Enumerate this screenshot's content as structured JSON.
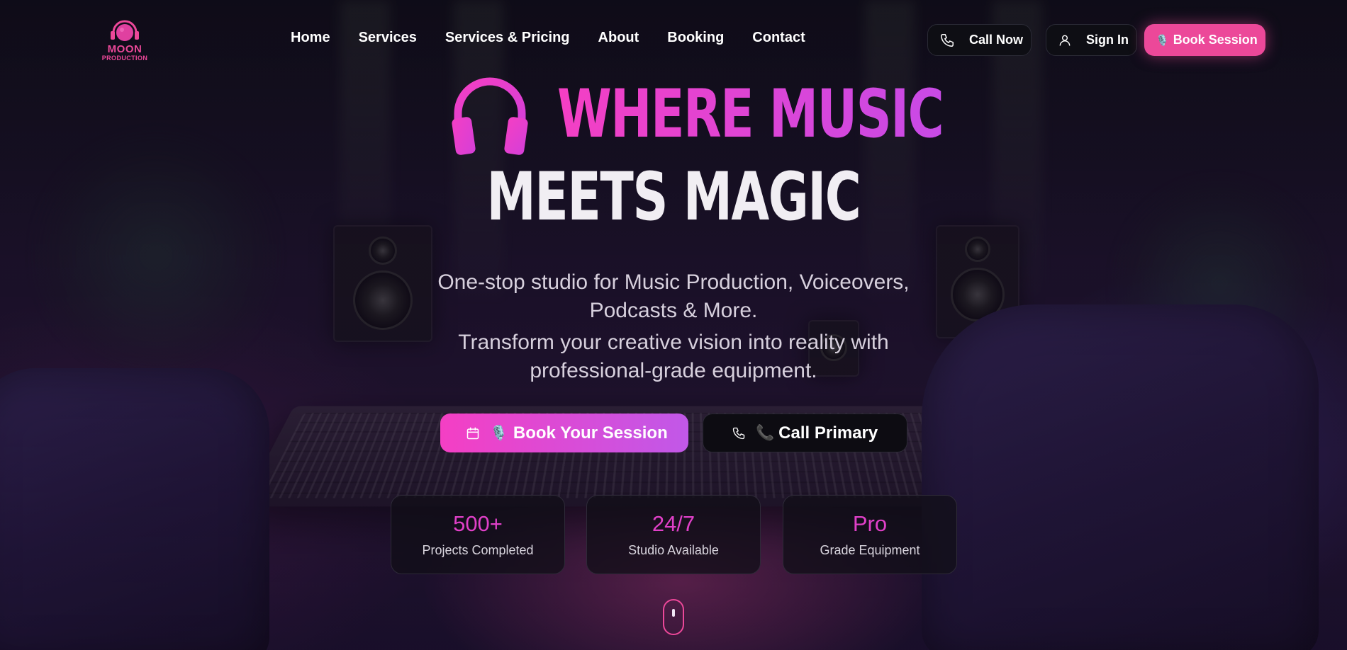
{
  "brand": {
    "line1": "MOON",
    "line2": "PRODUCTION",
    "icon": "moon-headphones-logo"
  },
  "nav": {
    "items": [
      {
        "label": "Home"
      },
      {
        "label": "Services"
      },
      {
        "label": "Services & Pricing"
      },
      {
        "label": "About"
      },
      {
        "label": "Booking"
      },
      {
        "label": "Contact"
      }
    ]
  },
  "header_actions": {
    "call_now": {
      "label": "Call Now",
      "icon": "phone-icon"
    },
    "sign_in": {
      "label": "Sign In",
      "icon": "user-icon"
    },
    "book_session": {
      "label": "Book Session",
      "emoji": "🎙️"
    }
  },
  "hero": {
    "headline_top": "WHERE MUSIC",
    "headline_bottom": "MEETS MAGIC",
    "headline_icon": "headphones-icon",
    "subtitle_line1": "One-stop studio for Music Production, Voiceovers,",
    "subtitle_line2": "Podcasts & More.",
    "desc_line1": "Transform your creative vision into reality with",
    "desc_line2": "professional-grade equipment.",
    "primary_cta": {
      "emoji": "🎙️",
      "label": "Book Your Session",
      "icon": "calendar-icon"
    },
    "secondary_cta": {
      "emoji": "📞",
      "label": "Call Primary",
      "icon": "phone-icon"
    }
  },
  "stats": [
    {
      "value": "500+",
      "label": "Projects Completed"
    },
    {
      "value": "24/7",
      "label": "Studio Available"
    },
    {
      "value": "Pro",
      "label": "Grade Equipment"
    }
  ],
  "scroll_indicator": {
    "icon": "mouse-scroll-icon"
  },
  "colors": {
    "accent": "#ec4899",
    "accent_purple": "#c84ae6",
    "dark_button": "#0e0e14"
  }
}
